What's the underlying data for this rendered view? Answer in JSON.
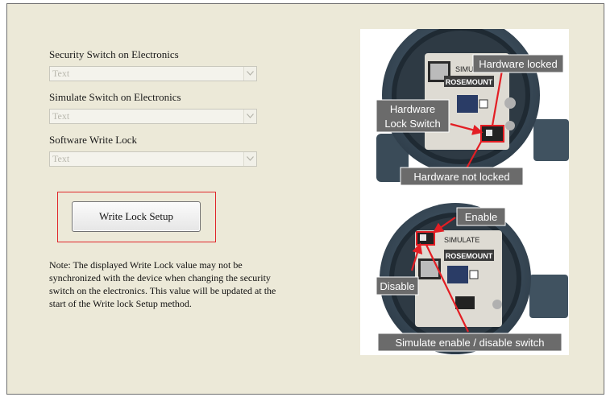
{
  "fields": [
    {
      "label": "Security Switch on Electronics",
      "value": "Text"
    },
    {
      "label": "Simulate Switch on Electronics",
      "value": "Text"
    },
    {
      "label": "Software Write Lock",
      "value": "Text"
    }
  ],
  "button": {
    "label": "Write Lock Setup"
  },
  "note": "Note: The displayed Write Lock value may not be synchronized with the device when changing the security switch on the electronics. This value will be updated at the start of the Write lock Setup method.",
  "image": {
    "top": {
      "brand": "ROSEMOUNT",
      "housing_text": "SIMULA",
      "callouts": {
        "locked": "Hardware locked",
        "switch_line1": "Hardware",
        "switch_line2": "Lock Switch",
        "not_locked": "Hardware not locked"
      }
    },
    "bottom": {
      "brand": "ROSEMOUNT",
      "housing_text": "SIMULATE",
      "callouts": {
        "enable": "Enable",
        "disable": "Disable",
        "switch": "Simulate enable / disable switch"
      }
    },
    "colors": {
      "housing": "#3d4e5b",
      "callout_bg": "#6b6b6b",
      "arrow": "#e31e24"
    }
  }
}
